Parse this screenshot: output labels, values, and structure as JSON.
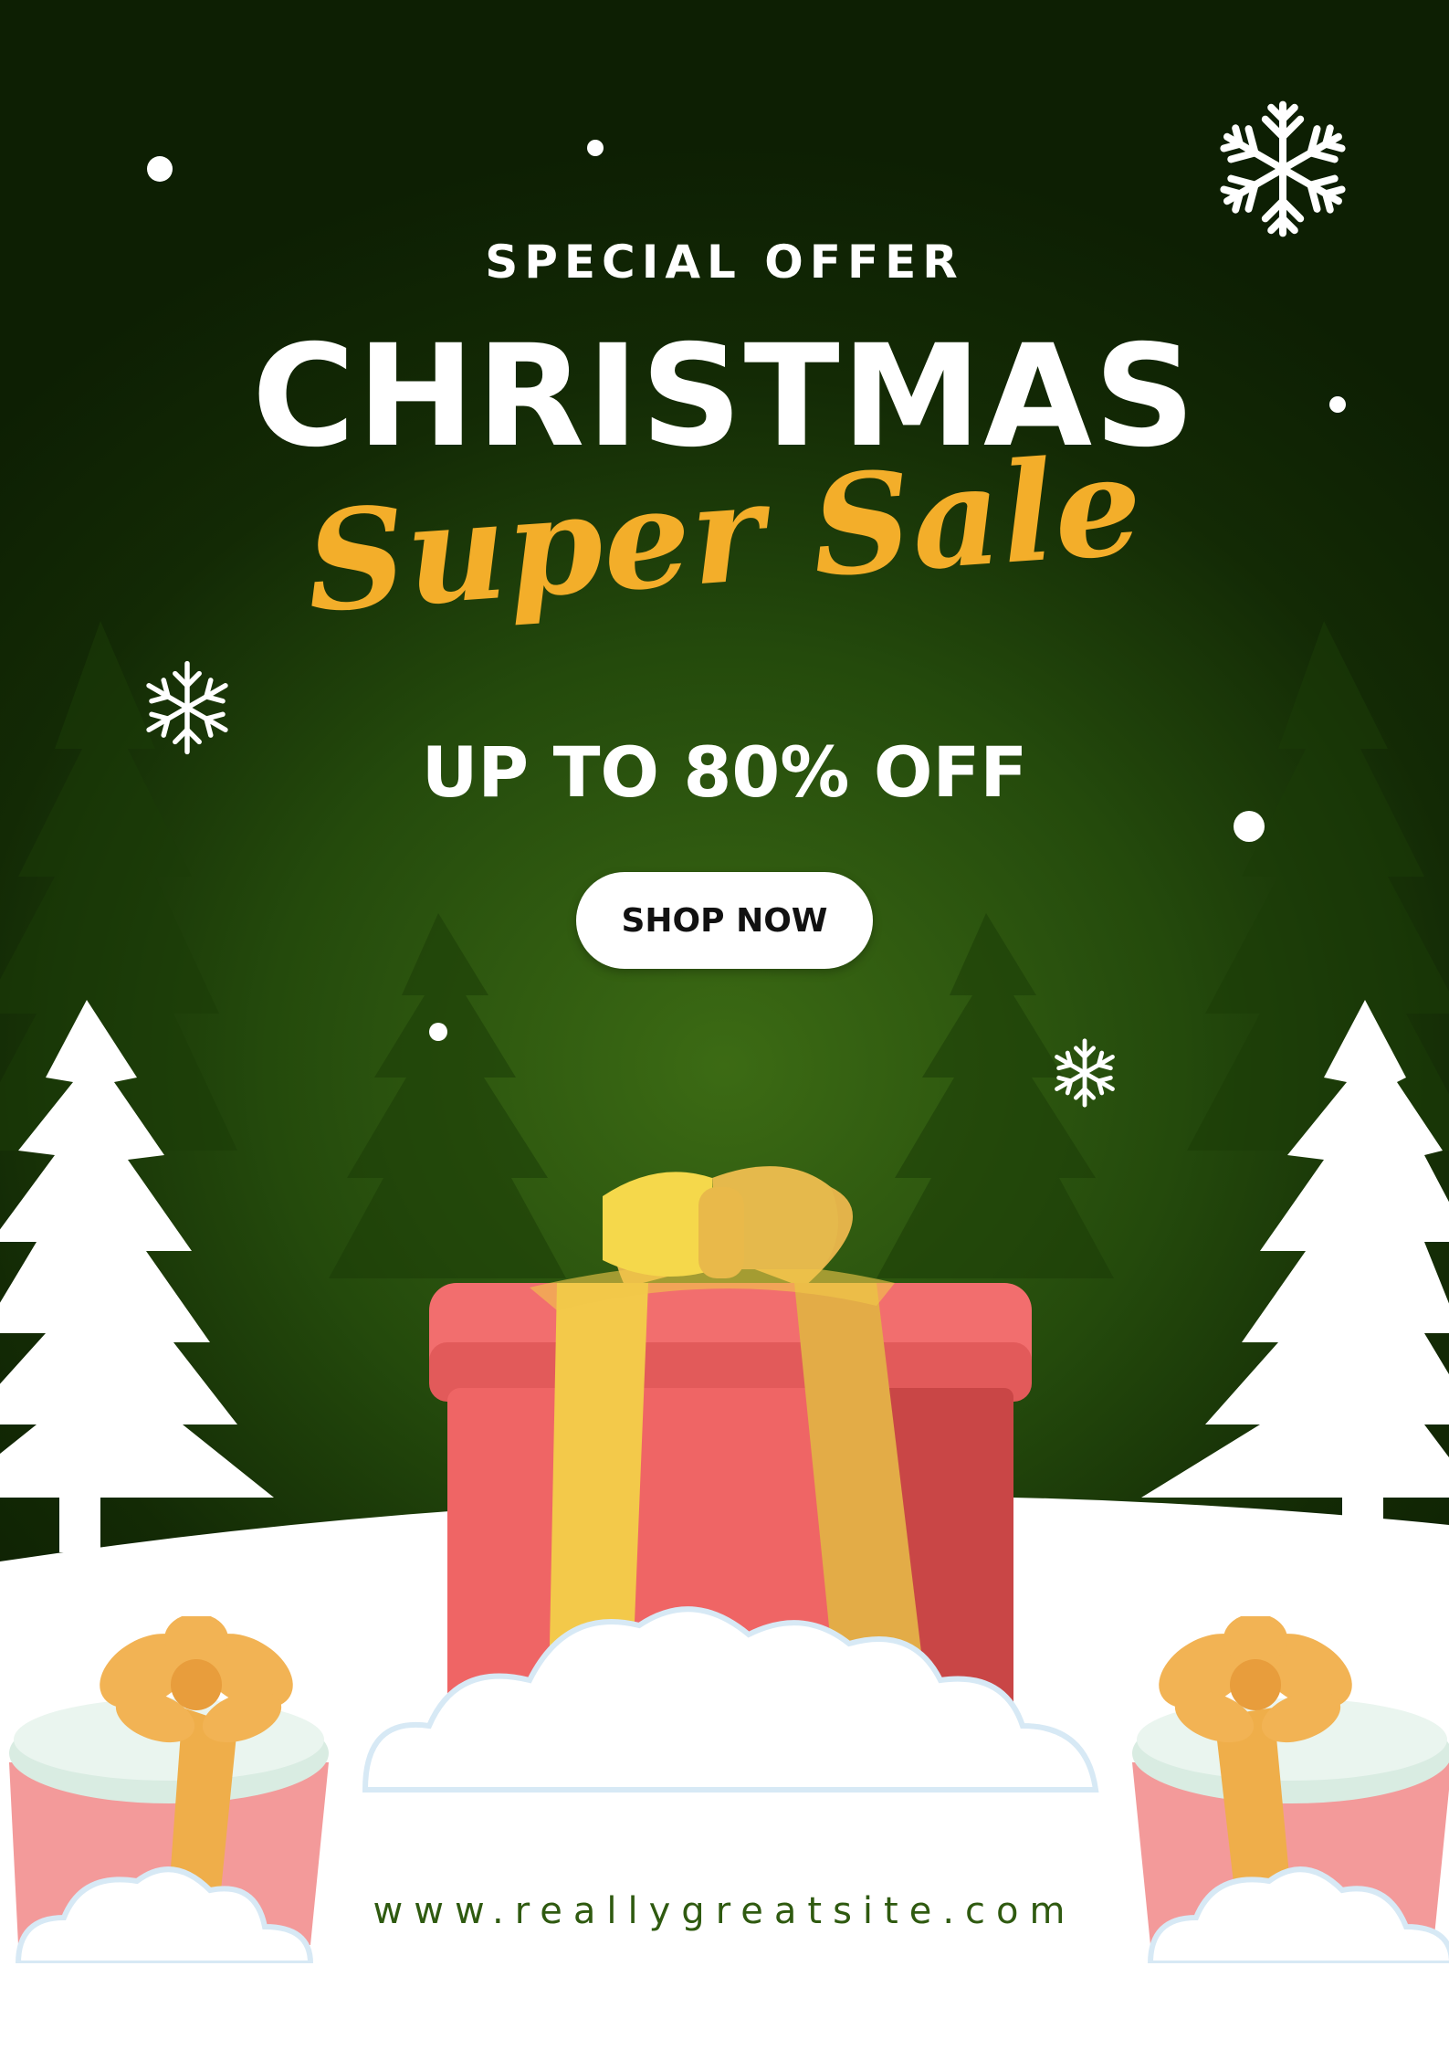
{
  "offer": {
    "kicker": "SPECIAL OFFER",
    "headline": "CHRISTMAS",
    "script_line": "Super Sale",
    "discount": "UP TO 80% OFF",
    "cta_label": "SHOP NOW"
  },
  "footer": {
    "website": "www.reallygreatsite.com"
  },
  "colors": {
    "background_dark": "#0d1f03",
    "background_glow": "#3c6b14",
    "script_gold": "#f3ae2a",
    "gift_red": "#f06a6a",
    "ribbon_gold": "#f2c84a",
    "snow_white": "#ffffff",
    "website_green": "#2f5a10"
  },
  "icons": [
    "snowflake-icon",
    "pine-tree-silhouette",
    "gift-box",
    "snow-cloud"
  ]
}
